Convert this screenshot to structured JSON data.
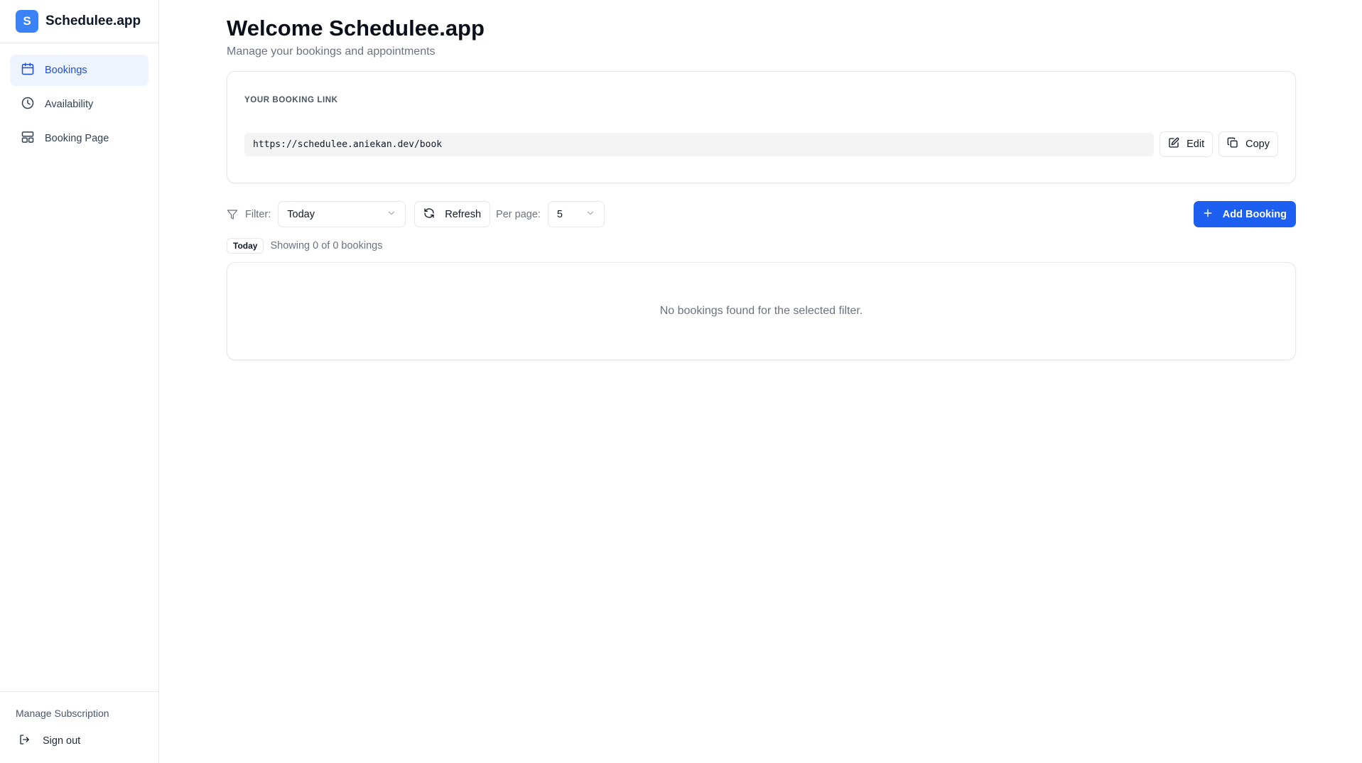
{
  "brand": {
    "logo_letter": "S",
    "name": "Schedulee.app",
    "accent_color": "#3b82f6"
  },
  "sidebar": {
    "items": [
      {
        "label": "Bookings",
        "icon": "calendar-icon",
        "active": true
      },
      {
        "label": "Availability",
        "icon": "clock-icon",
        "active": false
      },
      {
        "label": "Booking Page",
        "icon": "layout-icon",
        "active": false
      }
    ],
    "manage_subscription": "Manage Subscription",
    "sign_out": {
      "label": "Sign out",
      "icon": "logout-icon"
    }
  },
  "header": {
    "title": "Welcome Schedulee.app",
    "subtitle": "Manage your bookings and appointments"
  },
  "booking_link": {
    "label": "YOUR BOOKING LINK",
    "url": "https://schedulee.aniekan.dev/book",
    "edit_label": "Edit",
    "copy_label": "Copy"
  },
  "toolbar": {
    "filter_label": "Filter:",
    "filter_value": "Today",
    "refresh_label": "Refresh",
    "per_page_label": "Per page:",
    "per_page_value": "5",
    "add_booking_label": "Add Booking",
    "primary_color": "#1d5ff0"
  },
  "status": {
    "badge": "Today",
    "text": "Showing 0 of 0 bookings"
  },
  "bookings": {
    "empty_message": "No bookings found for the selected filter."
  }
}
